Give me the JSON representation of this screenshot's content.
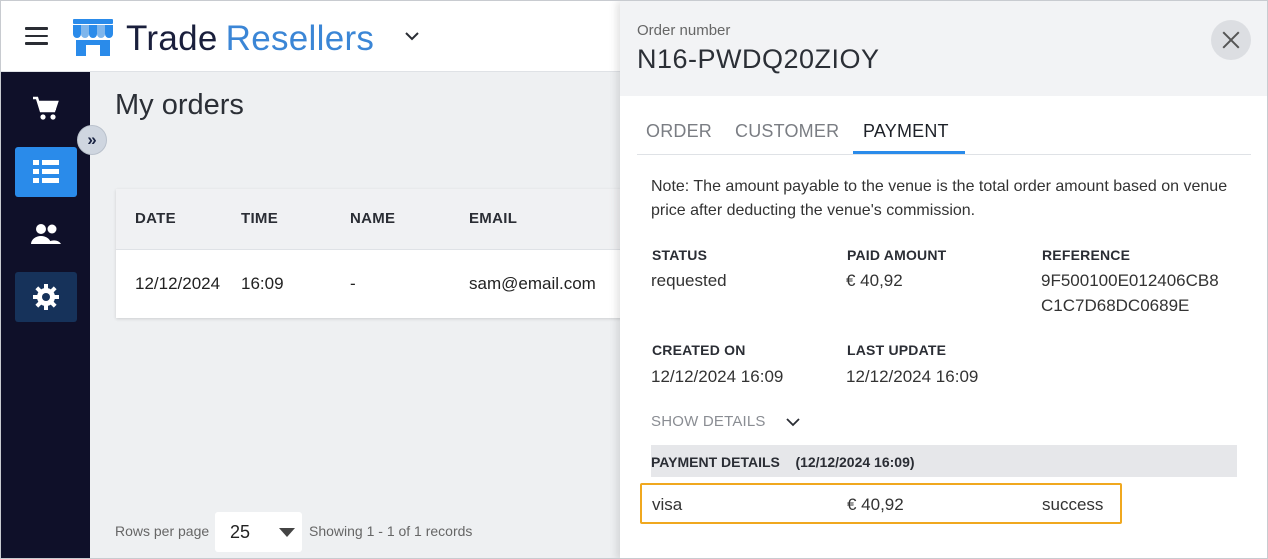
{
  "header": {
    "brand_part1": "Trade",
    "brand_part2": "Resellers"
  },
  "sidebar": {
    "items": [
      {
        "name": "cart",
        "icon": "cart-icon"
      },
      {
        "name": "orders",
        "icon": "list-icon",
        "active": true
      },
      {
        "name": "customers",
        "icon": "users-icon"
      },
      {
        "name": "settings",
        "icon": "gear-icon"
      }
    ],
    "collapse_glyph": "»"
  },
  "main": {
    "title": "My orders",
    "table": {
      "columns": [
        "DATE",
        "TIME",
        "NAME",
        "EMAIL"
      ],
      "rows": [
        {
          "date": "12/12/2024",
          "time": "16:09",
          "name": "-",
          "email": "sam@email.com"
        }
      ]
    },
    "pagination": {
      "rows_label": "Rows per page",
      "rows_value": "25",
      "showing": "Showing 1 - 1 of 1 records"
    }
  },
  "drawer": {
    "order_label": "Order number",
    "order_number": "N16-PWDQ20ZIOY",
    "tabs": [
      "ORDER",
      "CUSTOMER",
      "PAYMENT"
    ],
    "active_tab": "PAYMENT",
    "note": "Note: The amount payable to the venue is the total order amount based on venue price after deducting the venue's commission.",
    "fields": {
      "status_label": "STATUS",
      "status_value": "requested",
      "paid_label": "PAID AMOUNT",
      "paid_value": "€ 40,92",
      "reference_label": "REFERENCE",
      "reference_line1": "9F500100E012406CB8",
      "reference_line2": "C1C7D68DC0689E",
      "created_label": "CREATED ON",
      "created_value": "12/12/2024 16:09",
      "updated_label": "LAST UPDATE",
      "updated_value": "12/12/2024 16:09"
    },
    "show_details": "SHOW DETAILS",
    "payment_details": {
      "title": "PAYMENT DETAILS",
      "timestamp": "(12/12/2024 16:09)",
      "rows": [
        {
          "method": "visa",
          "amount": "€ 40,92",
          "result": "success"
        }
      ]
    }
  },
  "colors": {
    "sidebar_bg": "#0f1029",
    "accent": "#2a8bea",
    "brand_dark": "#1a1f3c",
    "brand_blue": "#3b86d6",
    "highlight": "#f0a81f"
  }
}
